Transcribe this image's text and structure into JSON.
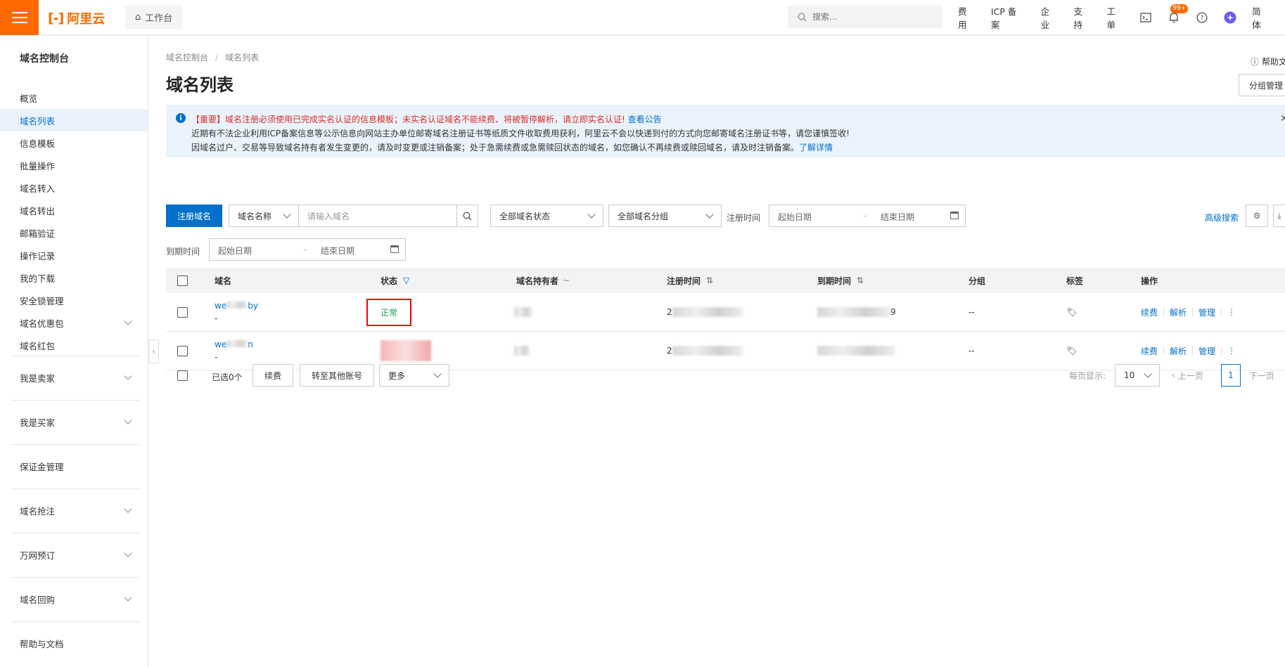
{
  "header": {
    "logo_text": "阿里云",
    "workbench": "工作台",
    "search_placeholder": "搜索...",
    "links": [
      "费用",
      "ICP 备案",
      "企业",
      "支持",
      "工单"
    ],
    "notification_badge": "99+",
    "lang": "简体"
  },
  "sidebar": {
    "title": "域名控制台",
    "items": [
      "概览",
      "域名列表",
      "信息模板",
      "批量操作",
      "域名转入",
      "域名转出",
      "邮箱验证",
      "操作记录",
      "我的下载",
      "安全锁管理",
      "域名优惠包",
      "域名红包"
    ],
    "groups": [
      "我是卖家",
      "我是买家",
      "保证金管理",
      "域名抢注",
      "万网预订",
      "域名回购",
      "帮助与文档"
    ]
  },
  "main": {
    "breadcrumb": [
      "域名控制台",
      "域名列表"
    ],
    "title": "域名列表",
    "help": "帮助文",
    "group_manage": "分组管理",
    "notice": {
      "line1_red": "【重要】域名注册必须使用已完成实名认证的信息模板；未实名认证域名不能续费、将被暂停解析，请立即实名认证!",
      "line1_link": "查看公告",
      "line2": "近期有不法企业利用ICP备案信息等公示信息向网站主办单位邮寄域名注册证书等纸质文件收取费用获利，阿里云不会以快递到付的方式向您邮寄域名注册证书等，请您谨慎签收!",
      "line3": "因域名过户、交易等导致域名持有者发生变更的，请及时变更或注销备案；处于急需续费或急需赎回状态的域名，如您确认不再续费或赎回域名，请及时注销备案。",
      "line3_link": "了解详情"
    },
    "filters": {
      "register_btn": "注册域名",
      "field_select": "域名名称",
      "domain_placeholder": "请输入域名",
      "status_select": "全部域名状态",
      "group_select": "全部域名分组",
      "reg_time_label": "注册时间",
      "exp_time_label": "到期时间",
      "start_date": "起始日期",
      "end_date": "结束日期",
      "advanced": "高级搜索"
    },
    "table": {
      "columns": [
        "域名",
        "状态",
        "域名持有者",
        "注册时间",
        "到期时间",
        "分组",
        "标签",
        "操作"
      ],
      "rows": [
        {
          "domain_a": "we",
          "domain_b": "by",
          "sub": "-",
          "status": "正常",
          "reg_a": "2",
          "exp_a": "",
          "exp_b": "9",
          "group": "--"
        },
        {
          "domain_a": "we",
          "domain_b": "n",
          "sub": "-",
          "status": "",
          "reg_a": "2",
          "exp_a": "",
          "exp_b": "",
          "group": "--"
        }
      ],
      "actions": [
        "续费",
        "解析",
        "管理"
      ]
    },
    "footer": {
      "selected": "已选0个",
      "renew": "续费",
      "transfer": "转至其他账号",
      "more": "更多",
      "per_page_label": "每页显示:",
      "per_page": "10",
      "prev": "上一页",
      "current_page": "1",
      "next": "下一页"
    }
  }
}
